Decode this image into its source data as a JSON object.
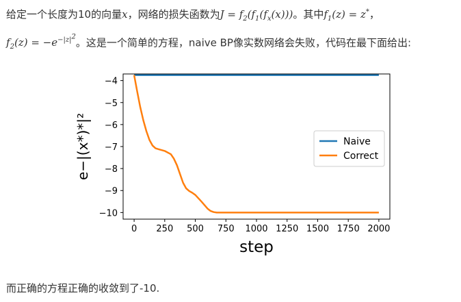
{
  "intro": {
    "t1": "给定一个长度为10的向量",
    "t2": "，网络的损失函数为",
    "t3": "。其中",
    "t4": "，",
    "t5": "。这是一个简单的方程，naive BP像实数网络会失败，代码在最下面给出:",
    "m_x": "x",
    "m_J": "J = f",
    "m_J2": "(f",
    "m_J3": "(f",
    "m_J4": "(x)))",
    "m_f1": "f",
    "m_f1b": "(z) = z",
    "m_f2": "f",
    "m_f2b": "(z) = −e",
    "sub1": "1",
    "sub2": "2",
    "subx": "x",
    "star": "*",
    "exp": "−|z|",
    "exp2": "2"
  },
  "conclusion": "而正确的方程正确的收敛到了-10.",
  "chart_data": {
    "type": "line",
    "title": "",
    "xlabel": "step",
    "ylabel": "e−|(x*)*|²",
    "xlim": [
      -90,
      2090
    ],
    "ylim": [
      -10.3,
      -3.7
    ],
    "xticks": [
      0,
      250,
      500,
      750,
      1000,
      1250,
      1500,
      1750,
      2000
    ],
    "yticks": [
      -4,
      -5,
      -6,
      -7,
      -8,
      -9,
      -10
    ],
    "ytick_labels": [
      "−4",
      "−5",
      "−6",
      "−7",
      "−8",
      "−9",
      "−10"
    ],
    "legend": "center-right",
    "series": [
      {
        "name": "Naive",
        "color": "#1f77b4",
        "x": [
          0,
          2000
        ],
        "y": [
          -3.75,
          -3.75
        ]
      },
      {
        "name": "Correct",
        "color": "#ff7f0e",
        "x": [
          0,
          25,
          50,
          75,
          100,
          125,
          150,
          175,
          200,
          250,
          300,
          325,
          350,
          375,
          400,
          425,
          450,
          475,
          500,
          550,
          600,
          625,
          650,
          675,
          700,
          750,
          800,
          1000,
          1500,
          2000
        ],
        "y": [
          -3.75,
          -4.5,
          -5.2,
          -5.8,
          -6.3,
          -6.7,
          -6.95,
          -7.08,
          -7.12,
          -7.2,
          -7.35,
          -7.55,
          -7.85,
          -8.25,
          -8.65,
          -8.9,
          -9.02,
          -9.1,
          -9.2,
          -9.5,
          -9.82,
          -9.93,
          -9.98,
          -10.0,
          -10.0,
          -10.0,
          -10.0,
          -10.0,
          -10.0,
          -10.0
        ]
      }
    ]
  }
}
